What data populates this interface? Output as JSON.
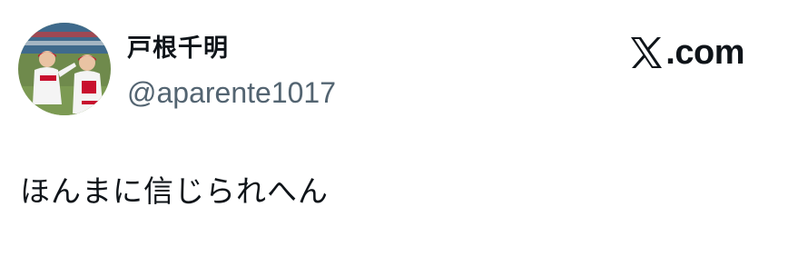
{
  "author": {
    "display_name": "戸根千明",
    "handle": "@aparente1017",
    "avatar_icon": "profile-photo-baseball-players"
  },
  "brand": {
    "icon": "x-logo-icon",
    "text": ".com"
  },
  "tweet": {
    "text": "ほんまに信じられへん"
  },
  "colors": {
    "text_primary": "#0f1419",
    "text_secondary": "#536471",
    "background": "#ffffff",
    "accent_red": "#d7263d"
  }
}
